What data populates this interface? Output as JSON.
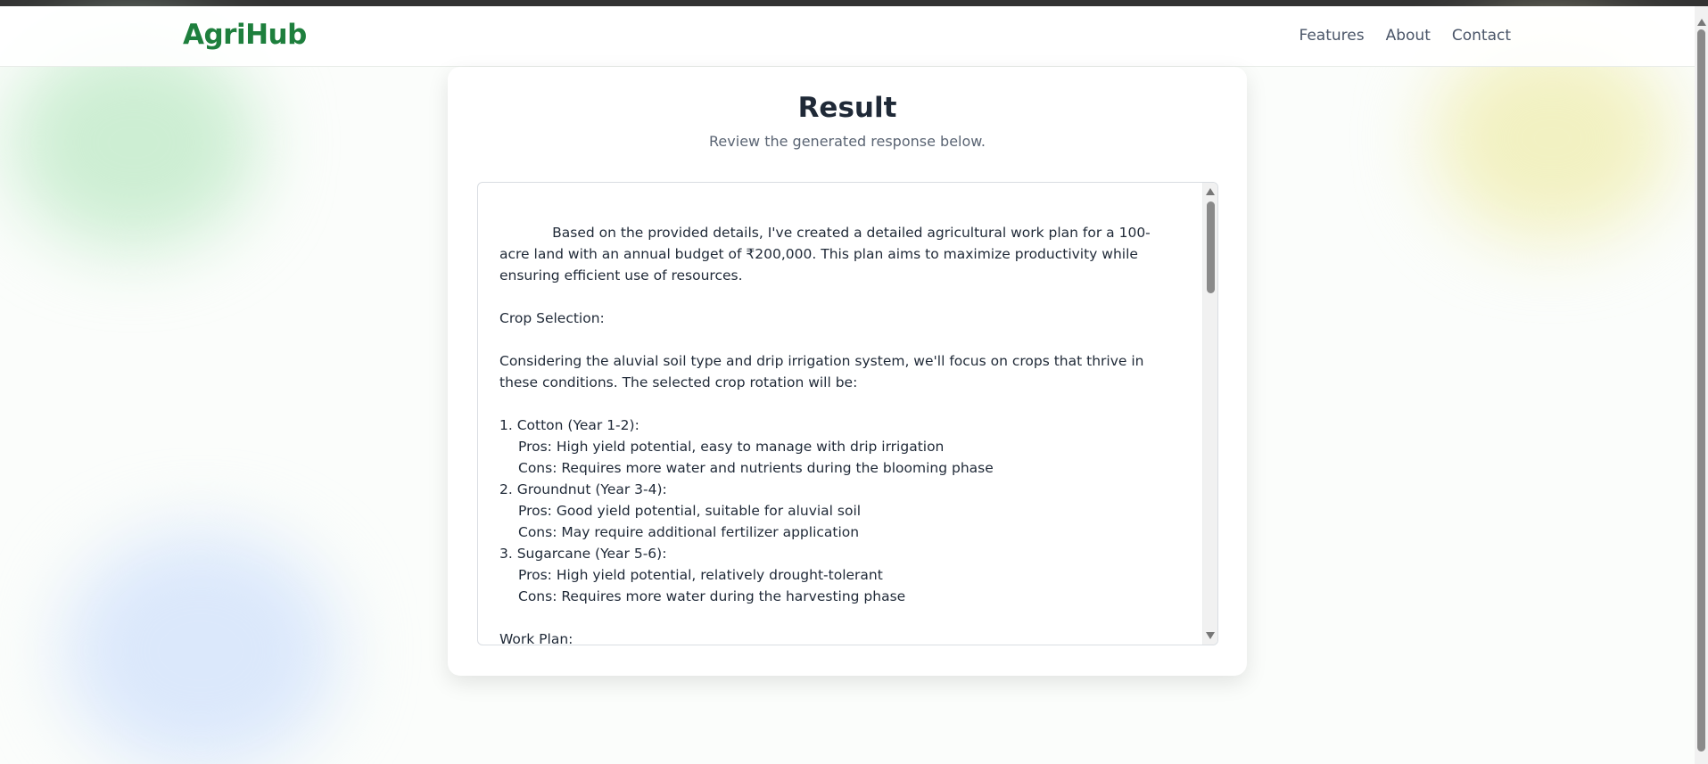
{
  "brand": "AgriHub",
  "nav": {
    "links": [
      "Features",
      "About",
      "Contact"
    ]
  },
  "result": {
    "title": "Result",
    "subtitle": "Review the generated response below.",
    "lines": [
      {
        "text": "            Based on the provided details, I've created a detailed agricultural work plan for a 100-",
        "indent": false
      },
      {
        "text": "acre land with an annual budget of ₹200,000. This plan aims to maximize productivity while",
        "indent": false
      },
      {
        "text": "ensuring efficient use of resources.",
        "indent": false
      },
      {
        "text": "",
        "indent": false
      },
      {
        "text": "Crop Selection:",
        "indent": false
      },
      {
        "text": "",
        "indent": false
      },
      {
        "text": "Considering the aluvial soil type and drip irrigation system, we'll focus on crops that thrive in",
        "indent": false
      },
      {
        "text": "these conditions. The selected crop rotation will be:",
        "indent": false
      },
      {
        "text": "",
        "indent": false
      },
      {
        "text": "1. Cotton (Year 1-2):",
        "indent": false
      },
      {
        "text": "Pros: High yield potential, easy to manage with drip irrigation",
        "indent": true
      },
      {
        "text": "Cons: Requires more water and nutrients during the blooming phase",
        "indent": true
      },
      {
        "text": "2. Groundnut (Year 3-4):",
        "indent": false
      },
      {
        "text": "Pros: Good yield potential, suitable for aluvial soil",
        "indent": true
      },
      {
        "text": "Cons: May require additional fertilizer application",
        "indent": true
      },
      {
        "text": "3. Sugarcane (Year 5-6):",
        "indent": false
      },
      {
        "text": "Pros: High yield potential, relatively drought-tolerant",
        "indent": true
      },
      {
        "text": "Cons: Requires more water during the harvesting phase",
        "indent": true
      },
      {
        "text": "",
        "indent": false
      },
      {
        "text": "Work Plan:",
        "indent": false
      }
    ]
  },
  "colors": {
    "brand": "#1e7f3d",
    "title": "#1f2937",
    "subtitle": "#5a6473"
  }
}
